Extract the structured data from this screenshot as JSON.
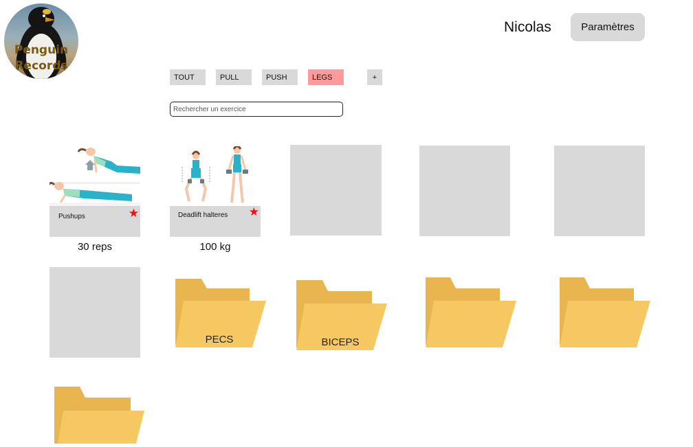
{
  "app": {
    "logo_text_line1": "Penguin",
    "logo_text_line2": "Records",
    "username": "Nicolas",
    "settings_label": "Paramètres"
  },
  "filters": {
    "tabs": [
      {
        "label": "TOUT",
        "active": false
      },
      {
        "label": "PULL",
        "active": false
      },
      {
        "label": "PUSH",
        "active": false
      },
      {
        "label": "LEGS",
        "active": true
      }
    ],
    "add_label": "+"
  },
  "search": {
    "placeholder": "Rechercher un exercice",
    "value": ""
  },
  "exercises": [
    {
      "name": "Pushups",
      "value": "30 reps",
      "favorite": true
    },
    {
      "name": "Deadlift halteres",
      "value": "100 kg",
      "favorite": true
    }
  ],
  "folders": [
    {
      "label": "PECS"
    },
    {
      "label": "BICEPS"
    },
    {
      "label": ""
    },
    {
      "label": ""
    },
    {
      "label": ""
    }
  ],
  "icons": {
    "favorite": "star-icon",
    "folder": "folder-icon"
  },
  "colors": {
    "active_tab": "#ff9a9a",
    "tab": "#d9d9d9",
    "card": "#d9d9d9",
    "star": "#ee1111",
    "folder_back": "#e8b54e",
    "folder_front": "#f5c862"
  }
}
